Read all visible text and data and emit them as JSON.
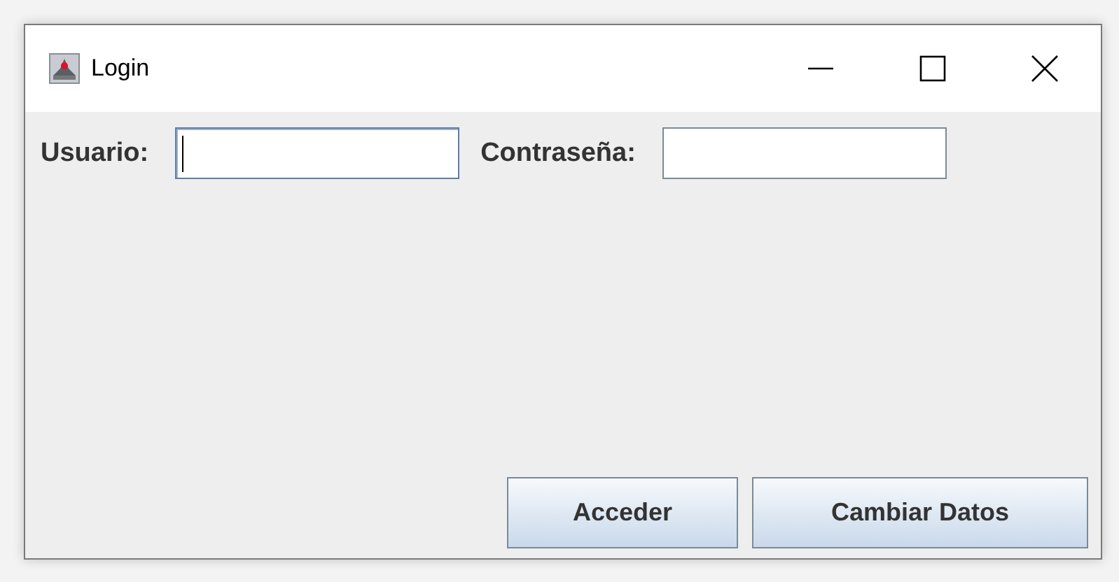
{
  "window": {
    "title": "Login"
  },
  "fields": [
    {
      "label": "Usuario:",
      "focused": true
    },
    {
      "label": "Contraseña:",
      "focused": false
    }
  ],
  "buttons": [
    "Acceder",
    "Cambiar Datos"
  ]
}
